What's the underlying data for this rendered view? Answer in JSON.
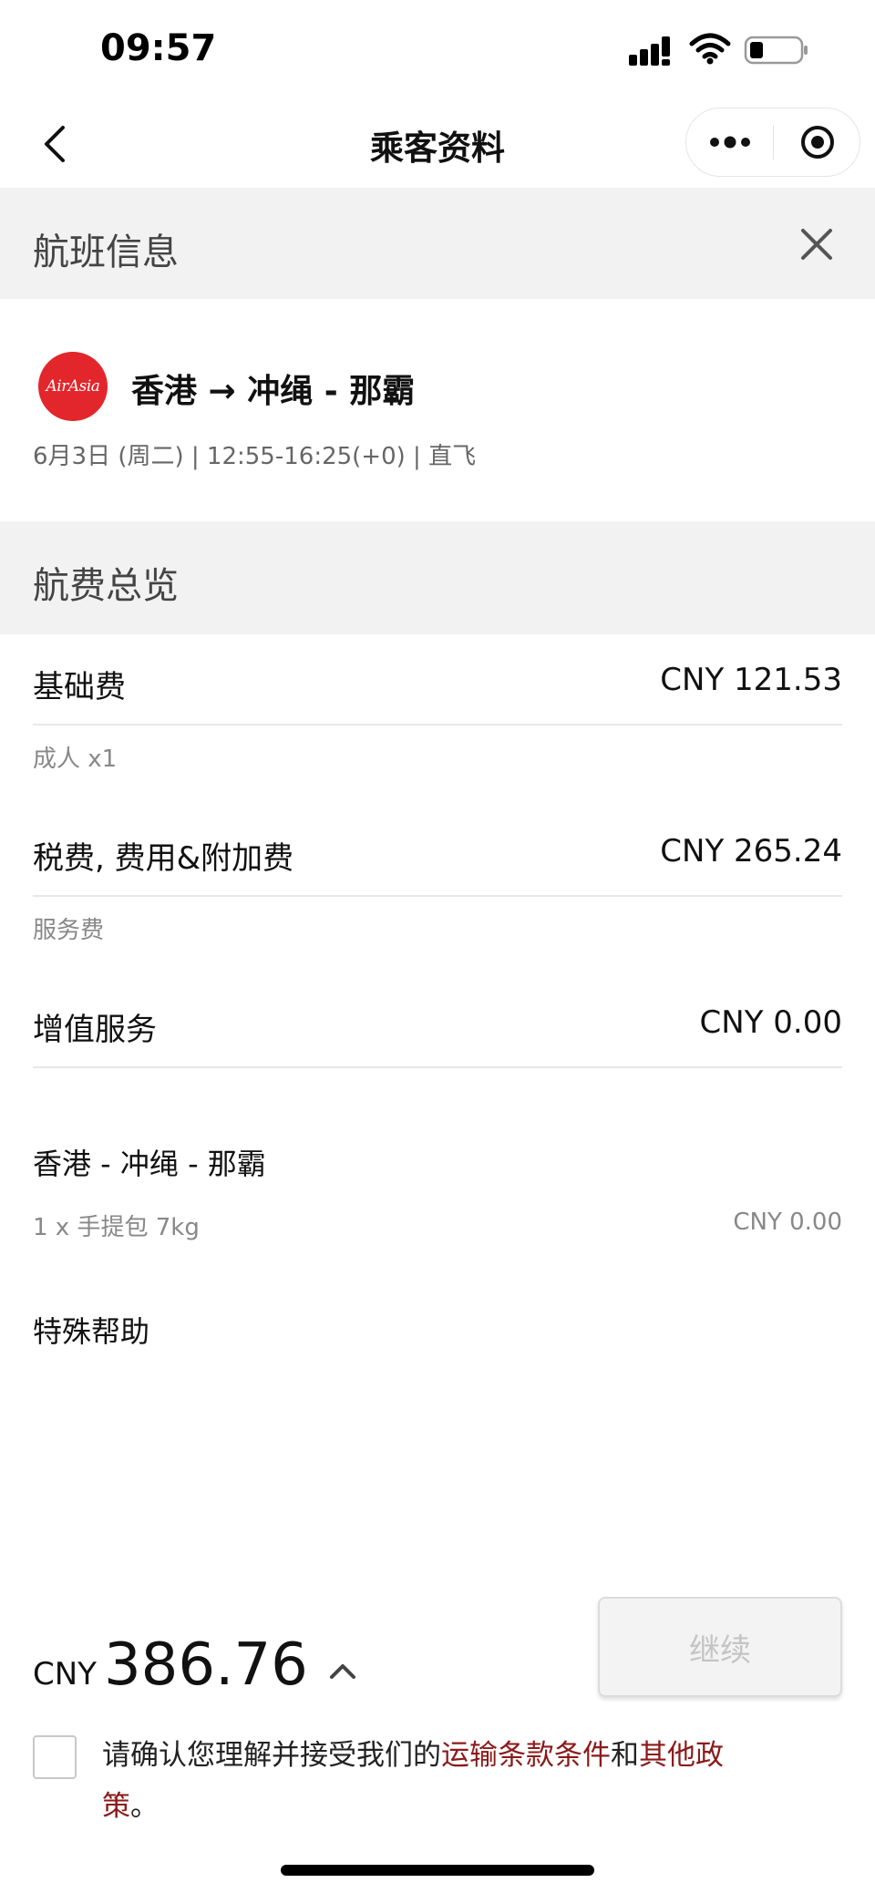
{
  "status_bar": {
    "time": "09:57"
  },
  "nav": {
    "title": "乘客资料"
  },
  "flight_section": {
    "header": "航班信息",
    "airline_logo_text": "AirAsia",
    "route": "香港 → 冲绳 - 那霸",
    "meta": "6月3日 (周二) | 12:55-16:25(+0) | 直飞"
  },
  "fare_section": {
    "header": "航费总览",
    "rows": [
      {
        "name": "基础费",
        "amount": "CNY  121.53",
        "sub": "成人 x1"
      },
      {
        "name": "税费, 费用&附加费",
        "amount": "CNY  265.24",
        "sub": "服务费"
      },
      {
        "name": "增值服务",
        "amount": "CNY  0.00"
      }
    ],
    "addon": {
      "segment": "香港 - 冲绳 - 那霸",
      "item": "1 x 手提包 7kg",
      "amount": "CNY   0.00"
    },
    "special_assistance": "特殊帮助"
  },
  "bottom": {
    "currency": "CNY",
    "total": "386.76",
    "continue_label": "继续",
    "terms_prefix": "请确认您理解并接受我们的",
    "terms_link1": "运输条款条件",
    "terms_and": "和",
    "terms_link2": "其他政策",
    "terms_suffix": "。"
  },
  "colors": {
    "brand_red": "#e3262b",
    "link_red": "#8b1a1a",
    "section_bg": "#f2f2f2"
  },
  "icons": [
    "back-icon",
    "more-icon",
    "target-icon",
    "close-icon",
    "chevron-up-icon",
    "signal-icon",
    "wifi-icon",
    "battery-icon"
  ]
}
